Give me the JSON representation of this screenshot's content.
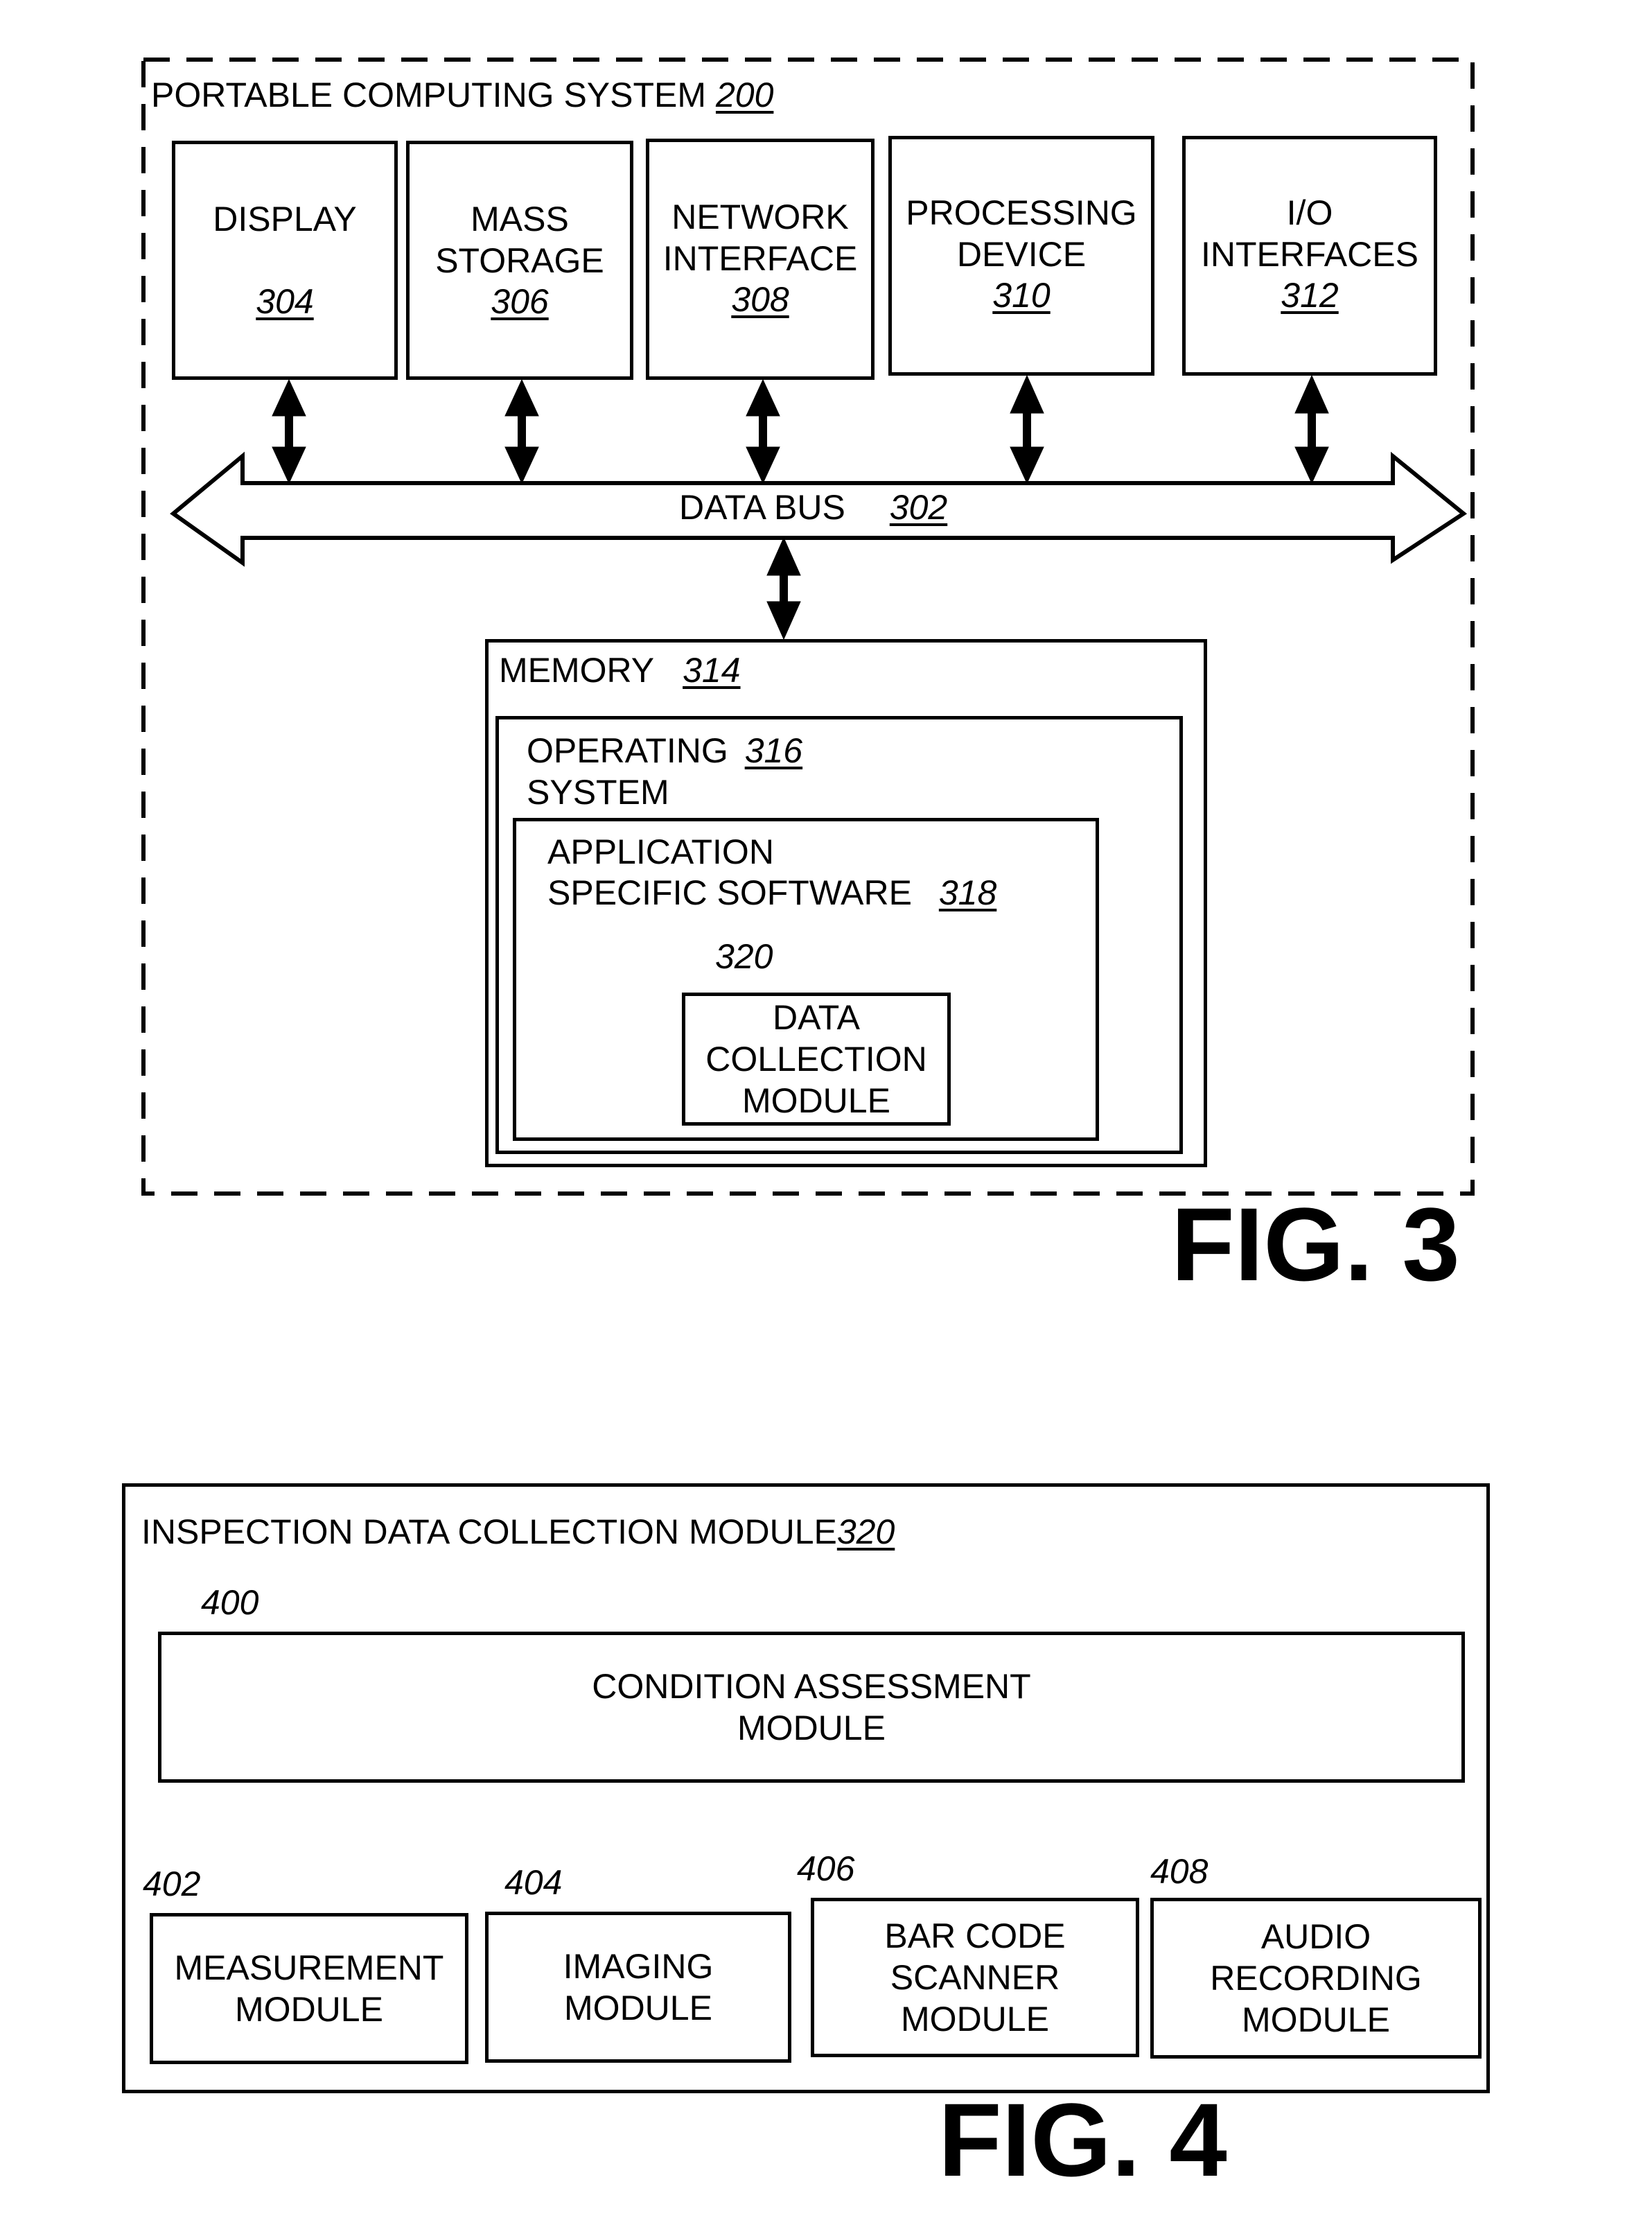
{
  "fig3": {
    "caption": "FIG. 3",
    "system": {
      "label": "PORTABLE COMPUTING SYSTEM",
      "ref": "200"
    },
    "components": [
      {
        "lines": [
          "DISPLAY",
          ""
        ],
        "ref": "304"
      },
      {
        "lines": [
          "MASS",
          "STORAGE"
        ],
        "ref": "306"
      },
      {
        "lines": [
          "NETWORK",
          "INTERFACE"
        ],
        "ref": "308"
      },
      {
        "lines": [
          "PROCESSING",
          "DEVICE"
        ],
        "ref": "310"
      },
      {
        "lines": [
          "I/O",
          "INTERFACES"
        ],
        "ref": "312"
      }
    ],
    "bus": {
      "label": "DATA BUS",
      "ref": "302"
    },
    "memory": {
      "label": "MEMORY",
      "ref": "314"
    },
    "os": {
      "line1": "OPERATING",
      "line2": "SYSTEM",
      "ref": "316"
    },
    "app": {
      "line1": "APPLICATION",
      "line2": "SPECIFIC SOFTWARE",
      "ref": "318"
    },
    "dcm": {
      "callout": "320",
      "lines": [
        "DATA",
        "COLLECTION",
        "MODULE"
      ]
    }
  },
  "fig4": {
    "caption": "FIG. 4",
    "container": {
      "label": "INSPECTION DATA COLLECTION MODULE",
      "ref": "320"
    },
    "condition": {
      "callout": "400",
      "line1": "CONDITION ASSESSMENT",
      "line2": "MODULE"
    },
    "modules": [
      {
        "callout": "402",
        "lines": [
          "MEASUREMENT",
          "MODULE"
        ]
      },
      {
        "callout": "404",
        "lines": [
          "IMAGING",
          "MODULE"
        ]
      },
      {
        "callout": "406",
        "lines": [
          "BAR CODE",
          "SCANNER",
          "MODULE"
        ]
      },
      {
        "callout": "408",
        "lines": [
          "AUDIO",
          "RECORDING",
          "MODULE"
        ]
      }
    ]
  }
}
